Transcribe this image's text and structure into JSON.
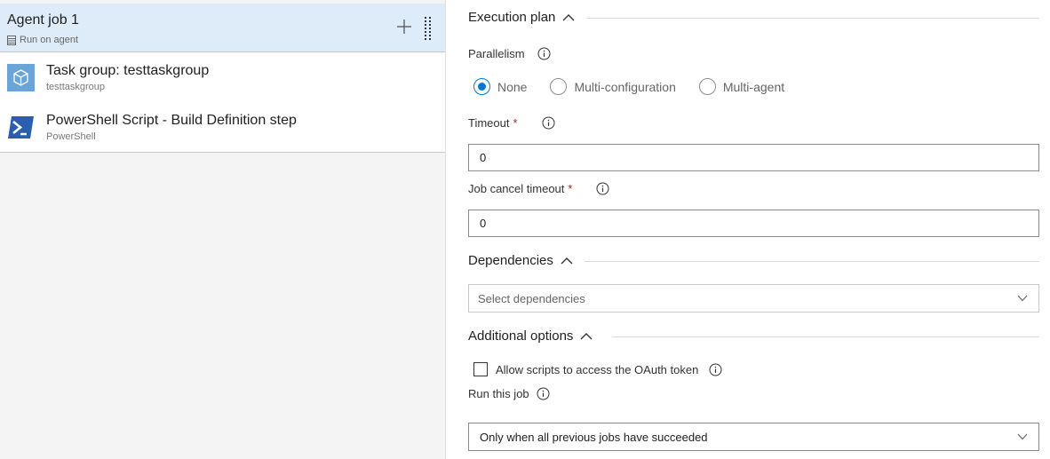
{
  "left_pane": {
    "job": {
      "title": "Agent job 1",
      "subtitle": "Run on agent"
    },
    "tasks": [
      {
        "title": "Task group: testtaskgroup",
        "subtitle": "testtaskgroup",
        "icon": "task-group-icon"
      },
      {
        "title": "PowerShell Script - Build Definition step",
        "subtitle": "PowerShell",
        "icon": "powershell-icon"
      }
    ]
  },
  "execution_plan": {
    "heading": "Execution plan",
    "parallelism_label": "Parallelism",
    "parallelism_options": [
      "None",
      "Multi-configuration",
      "Multi-agent"
    ],
    "parallelism_selected": "None",
    "timeout_label": "Timeout",
    "timeout_value": "0",
    "cancel_timeout_label": "Job cancel timeout",
    "cancel_timeout_value": "0",
    "required_marker": "*"
  },
  "dependencies": {
    "heading": "Dependencies",
    "placeholder": "Select dependencies"
  },
  "additional_options": {
    "heading": "Additional options",
    "oauth_label": "Allow scripts to access the OAuth token",
    "oauth_checked": false,
    "run_job_label": "Run this job",
    "run_job_value": "Only when all previous jobs have succeeded"
  },
  "colors": {
    "accent": "#0078d4",
    "selected_row": "#deecf9",
    "required": "#a4262c"
  }
}
